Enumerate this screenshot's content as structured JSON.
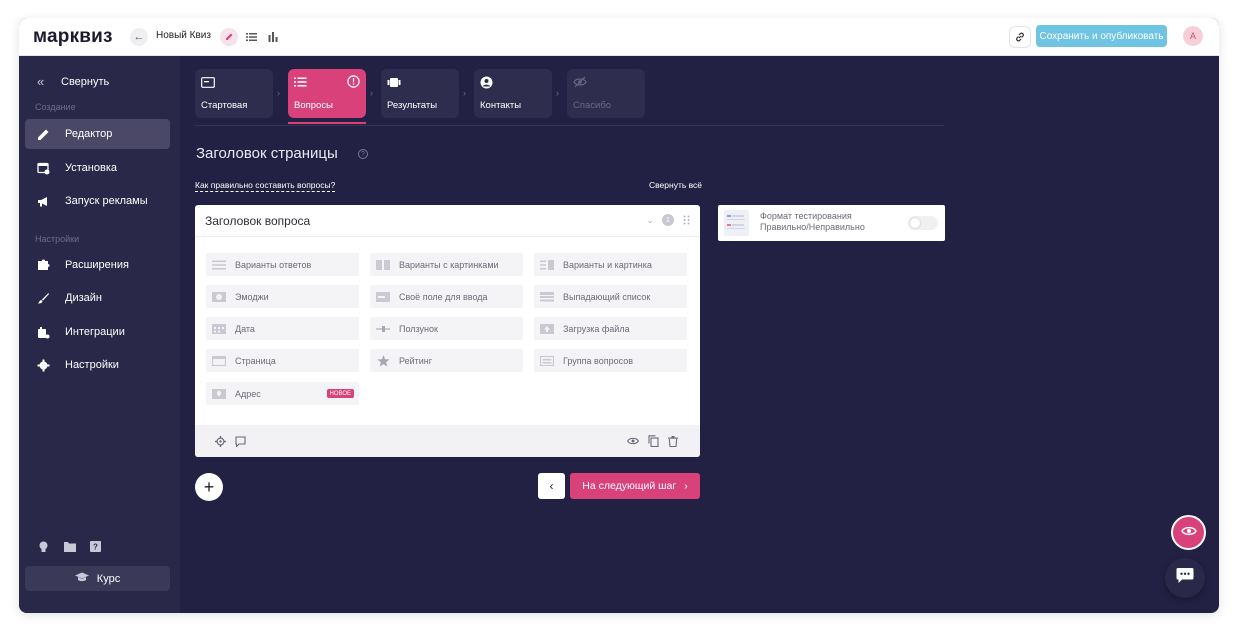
{
  "header": {
    "logo": "марквиз",
    "back_label": "←",
    "quiz_name": "Новый Квиз",
    "publish_label": "Сохранить и опубликовать",
    "avatar_initial": "A"
  },
  "sidebar": {
    "collapse_label": "Свернуть",
    "section_create": "Создание",
    "section_settings": "Настройки",
    "items": [
      {
        "label": "Редактор",
        "icon": "pencil-icon"
      },
      {
        "label": "Установка",
        "icon": "install-icon"
      },
      {
        "label": "Запуск рекламы",
        "icon": "megaphone-icon"
      },
      {
        "label": "Расширения",
        "icon": "puzzle-icon"
      },
      {
        "label": "Дизайн",
        "icon": "brush-icon"
      },
      {
        "label": "Интеграции",
        "icon": "integration-icon"
      },
      {
        "label": "Настройки",
        "icon": "gear-icon"
      }
    ],
    "course_label": "Курс"
  },
  "steps": [
    {
      "label": "Стартовая"
    },
    {
      "label": "Вопросы"
    },
    {
      "label": "Результаты"
    },
    {
      "label": "Контакты"
    },
    {
      "label": "Спасибо"
    }
  ],
  "main": {
    "page_title": "Заголовок страницы",
    "howto_link": "Как правильно составить вопросы?",
    "collapse_all": "Свернуть всё",
    "question_title": "Заголовок вопроса",
    "question_number": "1",
    "options": [
      "Варианты ответов",
      "Варианты с картинками",
      "Варианты и картинка",
      "Эмоджи",
      "Своё поле для ввода",
      "Выпадающий список",
      "Дата",
      "Ползунок",
      "Загрузка файла",
      "Страница",
      "Рейтинг",
      "Группа вопросов",
      "Адрес"
    ],
    "new_badge": "НОВОЕ",
    "add_label": "+",
    "next_label": "На следующий шаг",
    "format_line1": "Формат тестирования",
    "format_line2": "Правильно/Неправильно"
  },
  "colors": {
    "accent": "#d9417a",
    "sidebar": "#2a2848",
    "background": "#232143",
    "publish": "#6fc3e3"
  }
}
